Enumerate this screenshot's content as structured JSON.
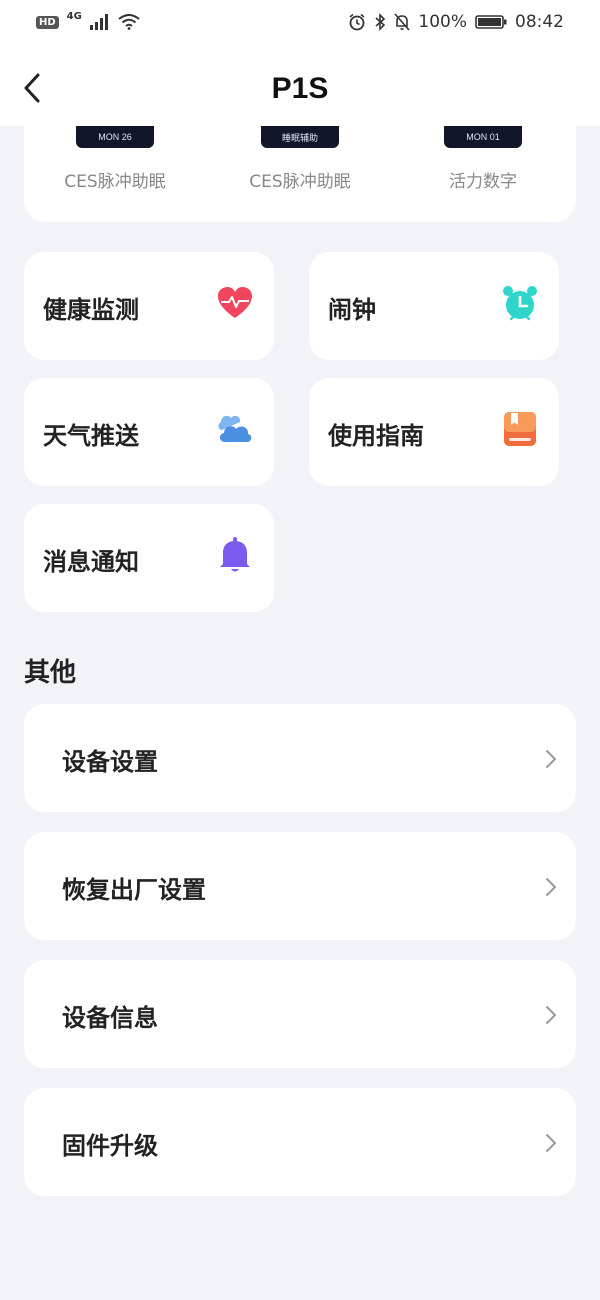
{
  "status_bar": {
    "hd": "HD",
    "network": "4G",
    "battery": "100%",
    "time": "08:42"
  },
  "header": {
    "title": "P1S"
  },
  "dials": [
    {
      "thumb_text": "MON 26",
      "label": "CES脉冲助眠"
    },
    {
      "thumb_text": "睡眠辅助",
      "label": "CES脉冲助眠"
    },
    {
      "thumb_text": "MON 01",
      "label": "活力数字"
    }
  ],
  "features": [
    {
      "label": "健康监测",
      "icon": "heart-icon"
    },
    {
      "label": "闹钟",
      "icon": "alarm-clock-icon"
    },
    {
      "label": "天气推送",
      "icon": "cloud-icon"
    },
    {
      "label": "使用指南",
      "icon": "guide-book-icon"
    },
    {
      "label": "消息通知",
      "icon": "bell-icon"
    }
  ],
  "others": {
    "title": "其他",
    "items": [
      {
        "label": "设备设置"
      },
      {
        "label": "恢复出厂设置"
      },
      {
        "label": "设备信息"
      },
      {
        "label": "固件升级"
      }
    ]
  },
  "colors": {
    "background": "#f2f3f8",
    "card": "#ffffff",
    "heart": "#f0455e",
    "alarm": "#2fd5c9",
    "cloud": "#4a90e2",
    "guide": "#f26d3d",
    "bell": "#7b5cf0"
  }
}
